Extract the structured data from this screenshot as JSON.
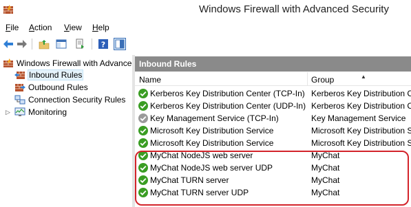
{
  "window": {
    "title": "Windows Firewall with Advanced Security",
    "icon": "firewall-icon"
  },
  "menu": {
    "items": [
      {
        "accel": "F",
        "rest": "ile"
      },
      {
        "accel": "A",
        "rest": "ction"
      },
      {
        "accel": "V",
        "rest": "iew"
      },
      {
        "accel": "H",
        "rest": "elp"
      }
    ]
  },
  "toolbar": {
    "buttons": [
      "back-icon",
      "forward-icon",
      "up-folder-icon",
      "show-hide-tree-icon",
      "export-list-icon",
      "help-icon",
      "properties-pane-icon"
    ]
  },
  "tree": {
    "root": "Windows Firewall with Advanced Security on Local Computer",
    "items": [
      {
        "label": "Inbound Rules",
        "icon": "inbound-rules-icon",
        "selected": true
      },
      {
        "label": "Outbound Rules",
        "icon": "outbound-rules-icon",
        "selected": false
      },
      {
        "label": "Connection Security Rules",
        "icon": "connection-security-icon",
        "selected": false
      },
      {
        "label": "Monitoring",
        "icon": "monitoring-icon",
        "selected": false
      }
    ]
  },
  "rules_pane": {
    "header": "Inbound Rules",
    "columns": {
      "name": "Name",
      "group": "Group"
    },
    "rows": [
      {
        "name": "Kerberos Key Distribution Center (TCP-In)",
        "group": "Kerberos Key Distribution C...",
        "enabled": true
      },
      {
        "name": "Kerberos Key Distribution Center (UDP-In)",
        "group": "Kerberos Key Distribution C...",
        "enabled": true
      },
      {
        "name": "Key Management Service (TCP-In)",
        "group": "Key Management Service",
        "enabled": false
      },
      {
        "name": "Microsoft Key Distribution Service",
        "group": "Microsoft Key Distribution S...",
        "enabled": true
      },
      {
        "name": "Microsoft Key Distribution Service",
        "group": "Microsoft Key Distribution S...",
        "enabled": true
      },
      {
        "name": "MyChat NodeJS web server",
        "group": "MyChat",
        "enabled": true
      },
      {
        "name": "MyChat NodeJS web server UDP",
        "group": "MyChat",
        "enabled": true
      },
      {
        "name": "MyChat TURN server",
        "group": "MyChat",
        "enabled": true
      },
      {
        "name": "MyChat TURN server UDP",
        "group": "MyChat",
        "enabled": true
      }
    ]
  },
  "colors": {
    "highlight": "#d3232a",
    "enabled_rule": "#3a9d23",
    "disabled_rule": "#9a9a9a",
    "header_bg": "#8a8a8a"
  }
}
